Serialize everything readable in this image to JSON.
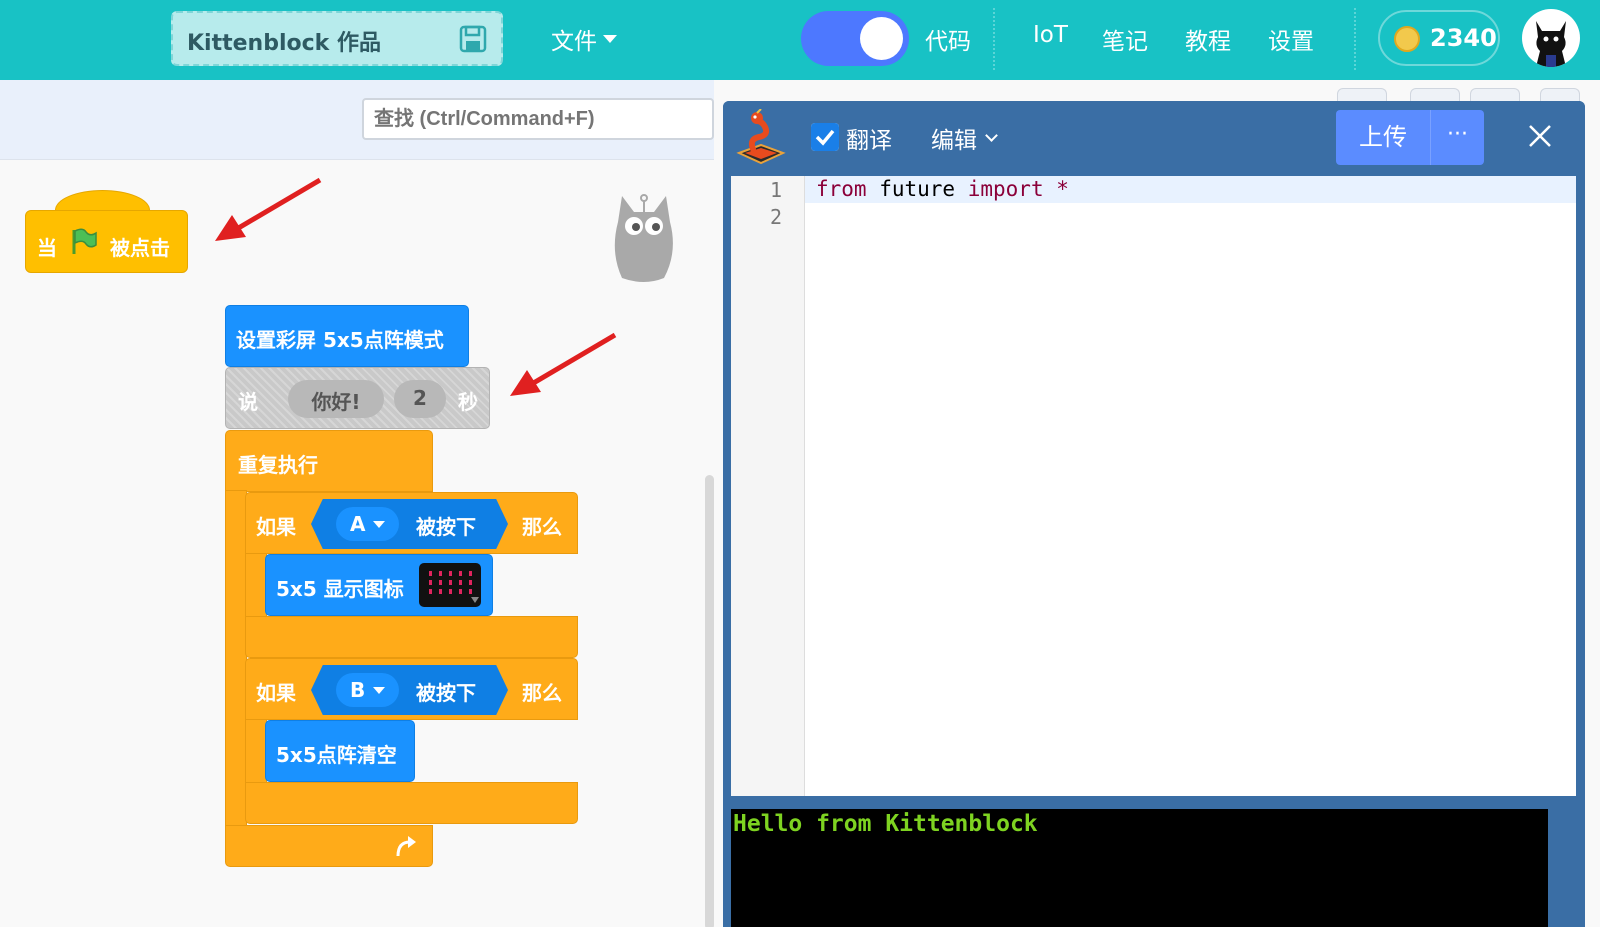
{
  "topbar": {
    "project_title": "Kittenblock 作品",
    "file_menu": "文件",
    "code_label": "代码",
    "nav": [
      "IoT",
      "笔记",
      "教程",
      "设置"
    ],
    "coins": "2340",
    "bg_color": "#18c2c5"
  },
  "workspace": {
    "search_placeholder": "查找 (Ctrl/Command+F)",
    "event_block": {
      "when": "当",
      "clicked": "被点击"
    },
    "set_mode": "设置彩屏 5x5点阵模式",
    "say": {
      "say": "说",
      "text": "你好!",
      "secs": "2",
      "unit": "秒"
    },
    "forever": "重复执行",
    "if_a": {
      "if": "如果",
      "key": "A",
      "pressed": "被按下",
      "then": "那么"
    },
    "show_icon": "5x5 显示图标",
    "if_b": {
      "if": "如果",
      "key": "B",
      "pressed": "被按下",
      "then": "那么"
    },
    "clear": "5x5点阵清空"
  },
  "codepanel": {
    "translate": "翻译",
    "edit": "编辑",
    "upload": "上传",
    "more": "···",
    "line_numbers": [
      "1",
      "2"
    ],
    "code": {
      "kw1": "from",
      "mod": " future ",
      "kw2": "import",
      "star": " *"
    },
    "console": "Hello from Kittenblock"
  }
}
